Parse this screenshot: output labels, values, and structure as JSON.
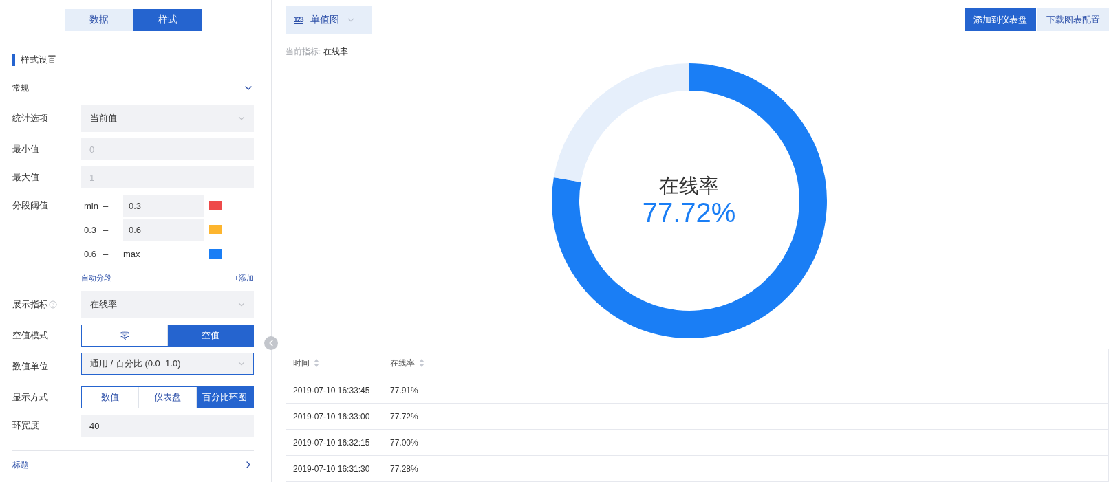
{
  "panel_tabs": [
    {
      "label": "数据",
      "selected": false
    },
    {
      "label": "样式",
      "selected": true
    }
  ],
  "section_title": "样式设置",
  "general_group": {
    "title": "常规",
    "expanded": true
  },
  "fields": [
    {
      "kind": "select",
      "label": "统计选项",
      "value": "当前值",
      "focused": false
    },
    {
      "kind": "input",
      "label": "最小值",
      "placeholder": "0"
    },
    {
      "kind": "input",
      "label": "最大值",
      "placeholder": "1"
    },
    {
      "kind": "thresholds",
      "label": "分段阈值",
      "segments": [
        {
          "from": "min",
          "separator": "–",
          "to": "0.3",
          "fixed": false,
          "color": "#ee4a4a"
        },
        {
          "from": "0.3",
          "separator": "–",
          "to": "0.6",
          "fixed": false,
          "color": "#fdb52e"
        },
        {
          "from": "0.6",
          "separator": "–",
          "to": "max",
          "fixed": true,
          "color": "#1a7ef5"
        }
      ],
      "auto_link": "自动分段",
      "add_link": "+添加"
    },
    {
      "kind": "select",
      "label": "展示指标",
      "help": true,
      "value": "在线率",
      "focused": false
    },
    {
      "kind": "segmented",
      "label": "空值模式",
      "options": [
        {
          "label": "零",
          "selected": false
        },
        {
          "label": "空值",
          "selected": true
        }
      ]
    },
    {
      "kind": "select",
      "label": "数值单位",
      "value": "通用 / 百分比 (0.0–1.0)",
      "focused": true
    },
    {
      "kind": "segmented",
      "label": "显示方式",
      "options": [
        {
          "label": "数值",
          "selected": false
        },
        {
          "label": "仪表盘",
          "selected": false
        },
        {
          "label": "百分比环图",
          "selected": true
        }
      ]
    },
    {
      "kind": "input",
      "label": "环宽度",
      "value": "40"
    }
  ],
  "title_group": {
    "title": "标题",
    "expanded": false
  },
  "chart_type": {
    "icon": "123",
    "label": "单值图"
  },
  "actions": [
    {
      "label": "添加到仪表盘",
      "kind": "primary"
    },
    {
      "label": "下载图表配置",
      "kind": "secondary"
    }
  ],
  "current_metric": {
    "label": "当前指标:",
    "value": "在线率"
  },
  "gauge": {
    "title": "在线率",
    "reading": "77.72%",
    "chart_data": {
      "type": "donut",
      "values": [
        77.72,
        22.28
      ]
    }
  },
  "table": {
    "columns": [
      "时间",
      "在线率"
    ],
    "rows": [
      [
        "2019-07-10 16:33:45",
        "77.91%"
      ],
      [
        "2019-07-10 16:33:00",
        "77.72%"
      ],
      [
        "2019-07-10 16:32:15",
        "77.00%"
      ],
      [
        "2019-07-10 16:31:30",
        "77.28%"
      ]
    ]
  }
}
